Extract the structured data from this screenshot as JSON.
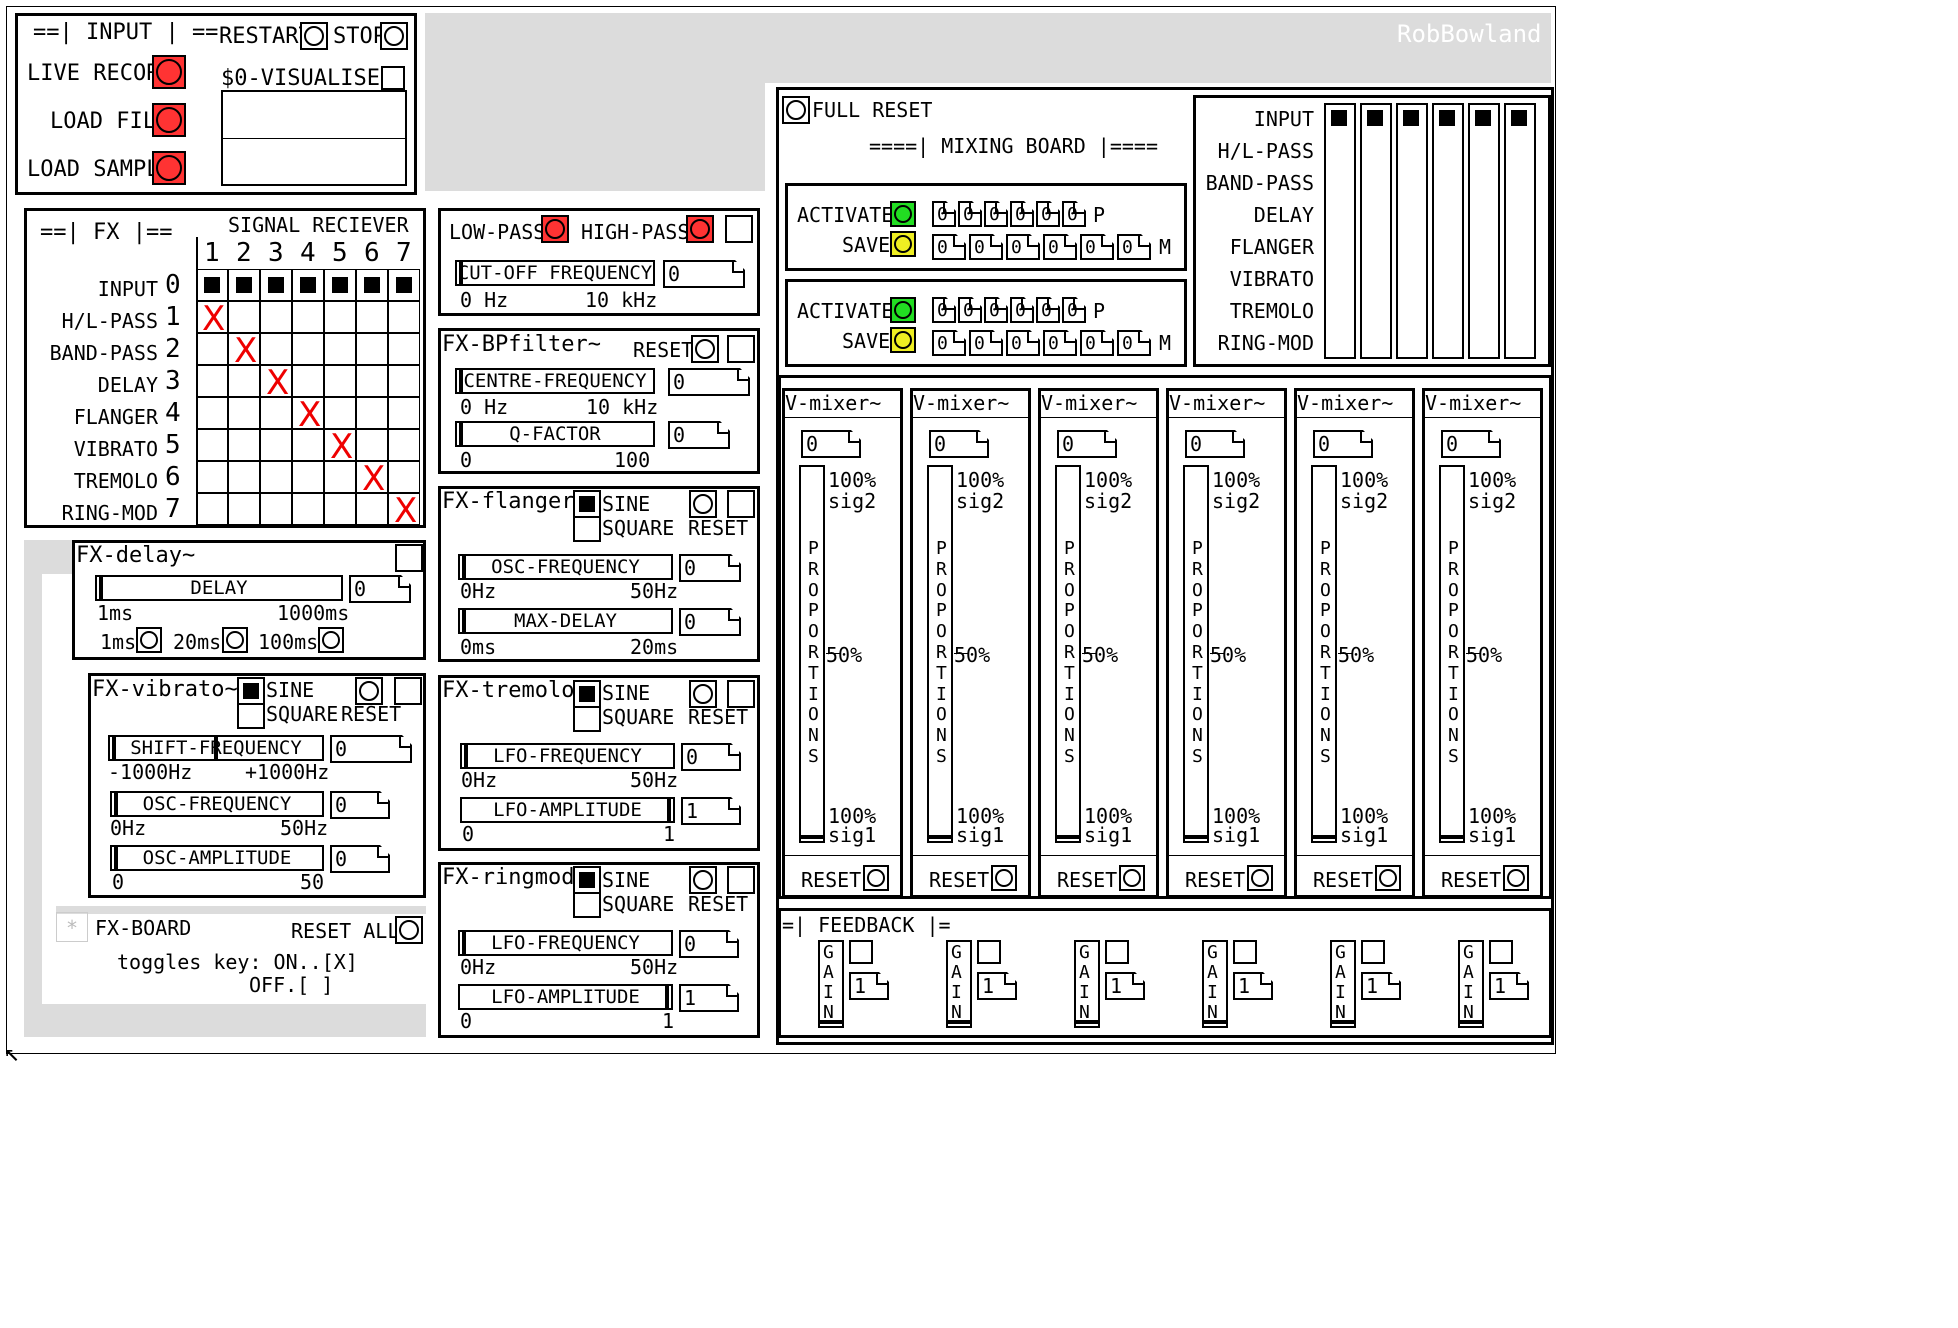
{
  "author": "RobBowland",
  "input": {
    "title": "==| INPUT | ==",
    "restart": "RESTART",
    "stop": "STOP",
    "live_record": "LIVE RECORD",
    "load_file": "LOAD FILE",
    "load_sample": "LOAD SAMPLE",
    "visualiser": "$0-VISUALISER"
  },
  "fx_matrix": {
    "title": "==| FX |==",
    "signal_receiver": "SIGNAL RECIEVER",
    "cols": [
      "1",
      "2",
      "3",
      "4",
      "5",
      "6",
      "7"
    ],
    "rows": [
      {
        "idx": "0",
        "label": "INPUT"
      },
      {
        "idx": "1",
        "label": "H/L-PASS"
      },
      {
        "idx": "2",
        "label": "BAND-PASS"
      },
      {
        "idx": "3",
        "label": "DELAY"
      },
      {
        "idx": "4",
        "label": "FLANGER"
      },
      {
        "idx": "5",
        "label": "VIBRATO"
      },
      {
        "idx": "6",
        "label": "TREMOLO"
      },
      {
        "idx": "7",
        "label": "RING-MOD"
      }
    ],
    "x_mark": "X"
  },
  "pass": {
    "low": "LOW-PASS",
    "high": "HIGH-PASS",
    "cutoff": "CUT-OFF FREQUENCY",
    "min": "0 Hz",
    "max": "10 kHz",
    "value": "0"
  },
  "bp": {
    "title": "FX-BPfilter~",
    "reset": "RESET",
    "centre": "CENTRE-FREQUENCY",
    "centre_min": "0 Hz",
    "centre_max": "10 kHz",
    "centre_val": "0",
    "q": "Q-FACTOR",
    "q_min": "0",
    "q_max": "100",
    "q_val": "0"
  },
  "flanger": {
    "title": "FX-flanger~",
    "sine": "SINE",
    "square": "SQUARE",
    "reset": "RESET",
    "osc": "OSC-FREQUENCY",
    "osc_min": "0Hz",
    "osc_max": "50Hz",
    "osc_val": "0",
    "delay": "MAX-DELAY",
    "delay_min": "0ms",
    "delay_max": "20ms",
    "delay_val": "0"
  },
  "tremolo": {
    "title": "FX-tremolo~",
    "sine": "SINE",
    "square": "SQUARE",
    "reset": "RESET",
    "lfo_f": "LFO-FREQUENCY",
    "lfo_f_min": "0Hz",
    "lfo_f_max": "50Hz",
    "lfo_f_val": "0",
    "lfo_a": "LFO-AMPLITUDE",
    "lfo_a_min": "0",
    "lfo_a_max": "1",
    "lfo_a_val": "1"
  },
  "ringmod": {
    "title": "FX-ringmod~",
    "sine": "SINE",
    "square": "SQUARE",
    "reset": "RESET",
    "lfo_f": "LFO-FREQUENCY",
    "lfo_f_min": "0Hz",
    "lfo_f_max": "50Hz",
    "lfo_f_val": "0",
    "lfo_a": "LFO-AMPLITUDE",
    "lfo_a_min": "0",
    "lfo_a_max": "1",
    "lfo_a_val": "1"
  },
  "delay": {
    "title": "FX-delay~",
    "label": "DELAY",
    "min": "1ms",
    "max": "1000ms",
    "val": "0",
    "p1": "1ms",
    "p2": "20ms",
    "p3": "100ms"
  },
  "vibrato": {
    "title": "FX-vibrato~",
    "sine": "SINE",
    "square": "SQUARE",
    "reset": "RESET",
    "shift": "SHIFT-FREQUENCY",
    "shift_min": "-1000Hz",
    "shift_max": "+1000Hz",
    "shift_val": "0",
    "osc_f": "OSC-FREQUENCY",
    "osc_f_min": "0Hz",
    "osc_f_max": "50Hz",
    "osc_f_val": "0",
    "osc_a": "OSC-AMPLITUDE",
    "osc_a_min": "0",
    "osc_a_max": "50",
    "osc_a_val": "0"
  },
  "board": {
    "star": "*",
    "title": "FX-BOARD",
    "reset_all": "RESET ALL",
    "key1": "toggles key: ON..[X]",
    "key2": "OFF.[ ]"
  },
  "mixing": {
    "full_reset": "FULL RESET",
    "title": "====| MIXING BOARD |====",
    "activate": "ACTIVATE",
    "save": "SAVE",
    "zero": "0",
    "p": "P",
    "m": "M",
    "routing_rows": [
      "INPUT",
      "H/L-PASS",
      "BAND-PASS",
      "DELAY",
      "FLANGER",
      "VIBRATO",
      "TREMOLO",
      "RING-MOD"
    ]
  },
  "vmixer": {
    "title": "V-mixer~",
    "val": "0",
    "top_pct": "100%",
    "top_sig": "sig2",
    "mid": "50%",
    "bot_pct": "100%",
    "bot_sig": "sig1",
    "vertical": [
      "P",
      "R",
      "O",
      "P",
      "O",
      "R",
      "T",
      "I",
      "O",
      "N",
      "S"
    ],
    "reset": "RESET"
  },
  "feedback": {
    "title": "=| FEEDBACK |=",
    "gain": [
      "G",
      "A",
      "I",
      "N"
    ],
    "val": "1"
  },
  "colors": {
    "record": "#ff3333",
    "activate": "#22dd22",
    "save": "#eeee22",
    "x_mark": "#ee0000"
  }
}
